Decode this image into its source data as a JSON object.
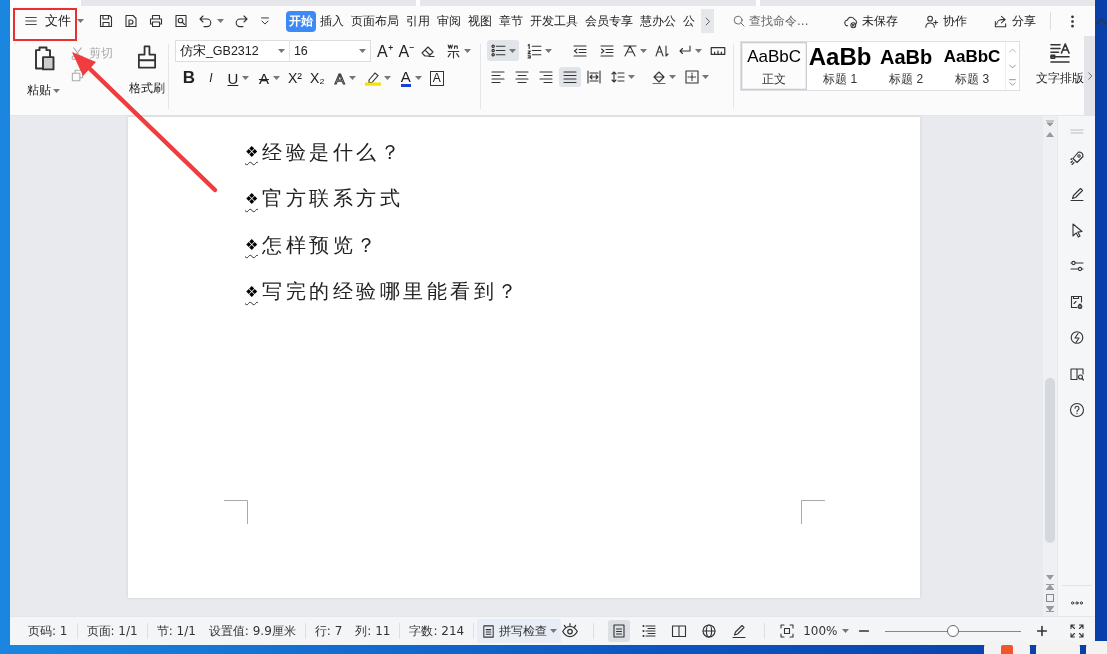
{
  "menu_button": {
    "label": "文件"
  },
  "tabs": [
    {
      "label": "开始",
      "selected": true
    },
    {
      "label": "插入",
      "selected": false
    },
    {
      "label": "页面布局",
      "selected": false
    },
    {
      "label": "引用",
      "selected": false
    },
    {
      "label": "审阅",
      "selected": false
    },
    {
      "label": "视图",
      "selected": false
    },
    {
      "label": "章节",
      "selected": false
    },
    {
      "label": "开发工具",
      "selected": false
    },
    {
      "label": "会员专享",
      "selected": false
    },
    {
      "label": "慧办公",
      "selected": false
    },
    {
      "label": "公",
      "selected": false
    }
  ],
  "search": {
    "placeholder": "查找命令..."
  },
  "header_actions": [
    {
      "kind": "unsaved",
      "label": "未保存"
    },
    {
      "kind": "collaborate",
      "label": "协作"
    },
    {
      "kind": "share",
      "label": "分享"
    }
  ],
  "clipboard": {
    "paste": "粘贴",
    "cut": {
      "label": "剪切",
      "disabled": true
    },
    "copy": {
      "disabled": true
    },
    "format_painter": "格式刷"
  },
  "font": {
    "name": "仿宋_GB2312",
    "size": "16"
  },
  "font_size_buttons": [
    "A⁺",
    "A⁻"
  ],
  "format_buttons": [
    {
      "kind": "bold",
      "glyph": "B"
    },
    {
      "kind": "italic",
      "glyph": "I"
    },
    {
      "kind": "underline",
      "glyph": "U"
    },
    {
      "kind": "strike",
      "glyph": "A"
    },
    {
      "kind": "plain",
      "glyph": "X²"
    },
    {
      "kind": "plain",
      "glyph": "X₂"
    },
    {
      "kind": "outline",
      "glyph": "A"
    },
    {
      "kind": "highlight"
    },
    {
      "kind": "color",
      "glyph": "A"
    },
    {
      "kind": "border",
      "glyph": "A"
    }
  ],
  "list_buttons": [
    {
      "kind": "bullets",
      "selected": true
    },
    {
      "kind": "numbering",
      "selected": false
    }
  ],
  "align_buttons": [
    {
      "kind": "left",
      "selected": false
    },
    {
      "kind": "center",
      "selected": false
    },
    {
      "kind": "right",
      "selected": false
    },
    {
      "kind": "justify",
      "selected": true
    },
    {
      "kind": "distributed",
      "selected": false
    }
  ],
  "styles": [
    {
      "kind": "body",
      "preview": "AaBbC",
      "label": "正文",
      "selected": true
    },
    {
      "kind": "heading1",
      "preview": "AaBb",
      "label": "标题 1",
      "selected": false
    },
    {
      "kind": "heading2",
      "preview": "AaBb",
      "label": "标题 2",
      "selected": false
    },
    {
      "kind": "heading3",
      "preview": "AaBbC",
      "label": "标题 3",
      "selected": false
    }
  ],
  "text_layout": {
    "label": "文字排版"
  },
  "document": {
    "bullet": "❖",
    "items": [
      "经验是什么？",
      "官方联系方式",
      "怎样预览？",
      "写完的经验哪里能看到？"
    ]
  },
  "status_bar": {
    "groups": [
      [
        "页码: 1"
      ],
      [
        "页面: 1/1"
      ],
      [
        "节: 1/1",
        "设置值: 9.9厘米"
      ],
      [
        "行: 7",
        "列: 11"
      ],
      [
        "字数: 214"
      ]
    ],
    "spell_check": "拼写检查",
    "view_modes": [
      {
        "kind": "page",
        "selected": true
      },
      {
        "kind": "outline",
        "selected": false
      },
      {
        "kind": "reading",
        "selected": false
      },
      {
        "kind": "web",
        "selected": false
      },
      {
        "kind": "draw",
        "selected": false
      }
    ],
    "zoom": "100%",
    "zoom_slider": {
      "level": 0.5
    }
  }
}
